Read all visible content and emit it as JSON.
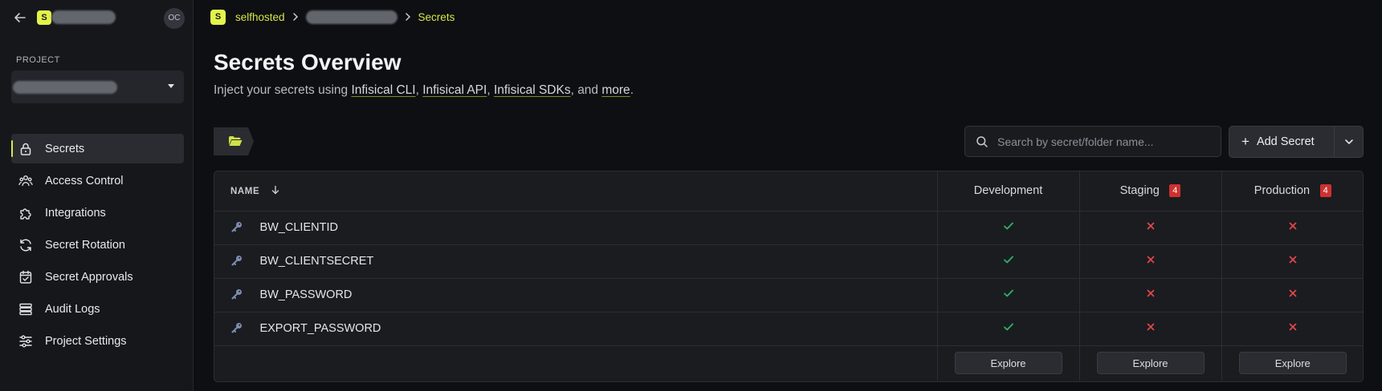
{
  "sidebar": {
    "org_initial": "S",
    "user_initials": "OC",
    "project_label": "PROJECT",
    "nav": [
      {
        "label": "Secrets",
        "icon": "lock-icon",
        "active": true
      },
      {
        "label": "Access Control",
        "icon": "users-icon"
      },
      {
        "label": "Integrations",
        "icon": "puzzle-icon"
      },
      {
        "label": "Secret Rotation",
        "icon": "rotate-icon"
      },
      {
        "label": "Secret Approvals",
        "icon": "calendar-check-icon"
      },
      {
        "label": "Audit Logs",
        "icon": "list-icon"
      },
      {
        "label": "Project Settings",
        "icon": "sliders-icon"
      }
    ]
  },
  "breadcrumb": {
    "org_initial": "S",
    "org_name": "selfhosted",
    "current": "Secrets"
  },
  "header": {
    "title": "Secrets Overview",
    "subtitle_prefix": "Inject your secrets using",
    "links": [
      "Infisical CLI",
      "Infisical API",
      "Infisical SDKs",
      "more"
    ],
    "sep1": ", ",
    "sep3": ", and ",
    "end": "."
  },
  "toolbar": {
    "search_placeholder": "Search by secret/folder name...",
    "add_label": "Add Secret"
  },
  "table": {
    "name_header": "NAME",
    "environments": [
      {
        "name": "Development",
        "missing_count": null
      },
      {
        "name": "Staging",
        "missing_count": "4"
      },
      {
        "name": "Production",
        "missing_count": "4"
      }
    ],
    "rows": [
      {
        "name": "BW_CLIENTID",
        "status": [
          "present",
          "missing",
          "missing"
        ]
      },
      {
        "name": "BW_CLIENTSECRET",
        "status": [
          "present",
          "missing",
          "missing"
        ]
      },
      {
        "name": "BW_PASSWORD",
        "status": [
          "present",
          "missing",
          "missing"
        ]
      },
      {
        "name": "EXPORT_PASSWORD",
        "status": [
          "present",
          "missing",
          "missing"
        ]
      }
    ],
    "explore_label": "Explore"
  },
  "colors": {
    "accent": "#e4f34a",
    "present": "#2fb36a",
    "missing": "#e0484a",
    "key_icon": "#7d8fb3"
  }
}
